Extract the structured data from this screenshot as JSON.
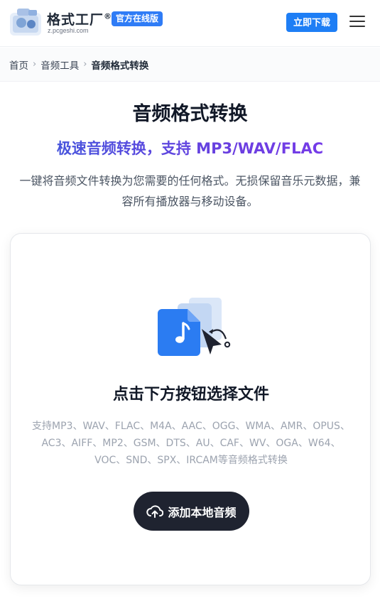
{
  "header": {
    "brand_name": "格式工厂",
    "brand_reg": "®",
    "brand_url": "z.pcgeshi.com",
    "official_badge": "官方在线版",
    "download_label": "立即下载"
  },
  "breadcrumb": {
    "items": [
      "首页",
      "音频工具",
      "音频格式转换"
    ]
  },
  "hero": {
    "title": "音频格式转换",
    "subtitle": "极速音频转换，支持 MP3/WAV/FLAC",
    "description": "一键将音频文件转换为您需要的任何格式。无损保留音乐元数据，兼容所有播放器与移动设备。"
  },
  "upload": {
    "title": "点击下方按钮选择文件",
    "formats": "支持MP3、WAV、FLAC、M4A、AAC、OGG、WMA、AMR、OPUS、AC3、AIFF、MP2、GSM、DTS、AU、CAF、WV、OGA、W64、VOC、SND、SPX、IRCAM等音频格式转换",
    "button_label": "添加本地音频"
  },
  "colors": {
    "accent": "#1e7ef5",
    "button_dark": "#1f2330",
    "subtitle_gradient_start": "#3b5bdb",
    "subtitle_gradient_end": "#7c3aed"
  }
}
